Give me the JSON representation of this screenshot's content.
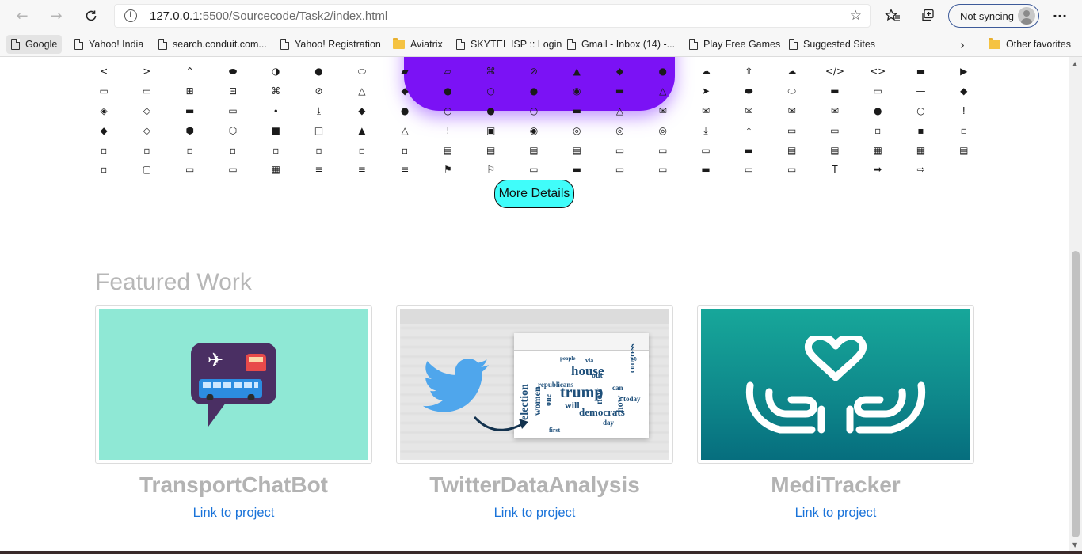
{
  "browser": {
    "url_host": "127.0.0.1",
    "url_rest": ":5500/Sourcecode/Task2/index.html",
    "sync_label": "Not syncing",
    "back_icon": "back-arrow-icon",
    "forward_icon": "forward-arrow-icon",
    "refresh_icon": "refresh-icon",
    "menu_glyph": "···"
  },
  "bookmarks": {
    "items": [
      {
        "label": "Google",
        "icon": "page-icon"
      },
      {
        "label": "Yahoo! India",
        "icon": "page-icon"
      },
      {
        "label": "search.conduit.com...",
        "icon": "page-icon"
      },
      {
        "label": "Yahoo! Registration",
        "icon": "page-icon"
      },
      {
        "label": "Aviatrix",
        "icon": "folder-icon"
      },
      {
        "label": "SKYTEL ISP :: Login",
        "icon": "page-icon"
      },
      {
        "label": "Gmail - Inbox (14) -...",
        "icon": "page-icon"
      },
      {
        "label": "Play Free Games",
        "icon": "page-icon"
      },
      {
        "label": "Suggested Sites",
        "icon": "page-icon"
      }
    ],
    "other": "Other favorites"
  },
  "icon_grid": [
    [
      "<",
      ">",
      "⌃",
      "⬬",
      "◑",
      "●",
      "⬭",
      "▰",
      "▱",
      "⌘",
      "⊘",
      "▲",
      "◆",
      "●",
      "☁",
      "⇧",
      "☁",
      "</>",
      "<>",
      "▬",
      "▶"
    ],
    [
      "▭",
      "▭",
      "⊞",
      "⊟",
      "⌘",
      "⊘",
      "△",
      "◆",
      "●",
      "○",
      "●",
      "◉",
      "▬",
      "△",
      "➤",
      "⬬",
      "⬭",
      "▬",
      "▭",
      "—",
      "◆"
    ],
    [
      "◈",
      "◇",
      "▬",
      "▭",
      "∙",
      "⤓",
      "◆",
      "●",
      "○",
      "●",
      "○",
      "▬",
      "△",
      "✉",
      "✉",
      "✉",
      "✉",
      "✉",
      "●",
      "○",
      "!"
    ],
    [
      "◆",
      "◇",
      "⬢",
      "⬡",
      "■",
      "□",
      "▲",
      "△",
      "!",
      "▣",
      "◉",
      "◎",
      "◎",
      "◎",
      "⤓",
      "⤒",
      "▭",
      "▭",
      "▫",
      "▪",
      "▫"
    ],
    [
      "▫",
      "▫",
      "▫",
      "▫",
      "▫",
      "▫",
      "▫",
      "▫",
      "▤",
      "▤",
      "▤",
      "▤",
      "▭",
      "▭",
      "▭",
      "▬",
      "▤",
      "▤",
      "▦",
      "▦",
      "▤"
    ],
    [
      "▫",
      "▢",
      "▭",
      "▭",
      "▦",
      "≡",
      "≡",
      "≡",
      "⚑",
      "⚐",
      "▭",
      "▬",
      "▭",
      "▭",
      "▬",
      "▭",
      "▭",
      "T",
      "➡",
      "⇨",
      ""
    ]
  ],
  "more_button": "More Details",
  "featured": {
    "title": "Featured Work",
    "cards": [
      {
        "title": "TransportChatBot",
        "link": "Link to project"
      },
      {
        "title": "TwitterDataAnalysis",
        "link": "Link to project"
      },
      {
        "title": "MediTracker",
        "link": "Link to project"
      }
    ]
  },
  "wordcloud": [
    "house",
    "trump",
    "election",
    "women",
    "republicans",
    "people",
    "new",
    "democrats",
    "will",
    "how",
    "first",
    "today",
    "can",
    "via",
    "out",
    "one",
    "day",
    "congress"
  ],
  "colors": {
    "more_button_bg": "#40fdfa",
    "link": "#1a73d9",
    "muted_title": "#b7b7b7",
    "logo_purple": "#7b12f5"
  }
}
